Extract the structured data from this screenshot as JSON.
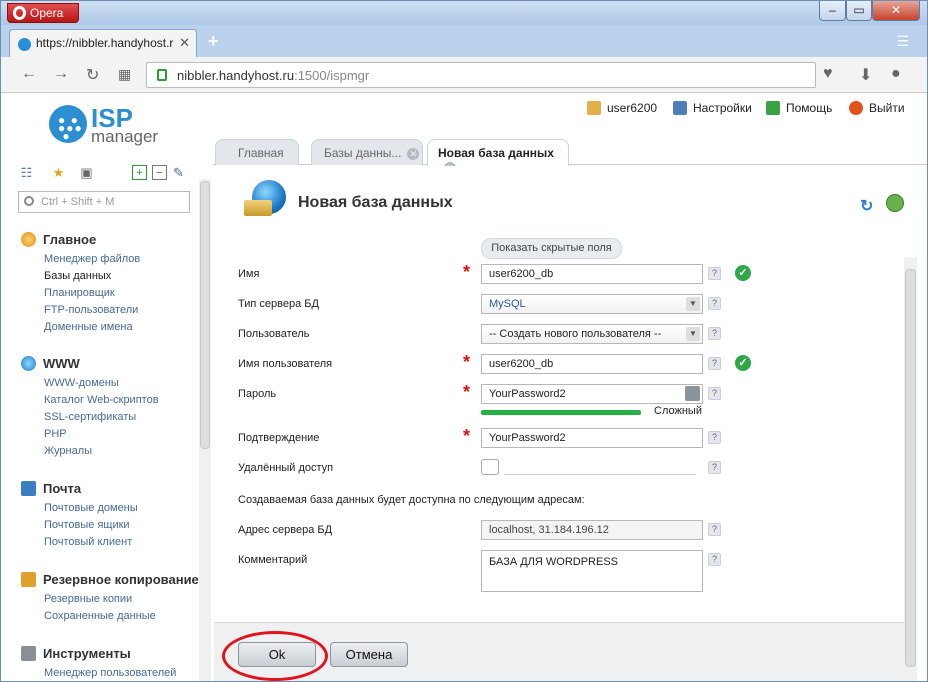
{
  "browser": {
    "app_name": "Opera",
    "tab_title": "https://nibbler.handyhost.r",
    "url_host": "nibbler.handyhost.ru",
    "url_rest": ":1500/ispmgr",
    "win_min": "–",
    "win_max": "▭",
    "win_close": "✕",
    "new_tab": "+"
  },
  "app": {
    "logo_top": "ISP",
    "logo_bottom": "manager",
    "user": "user6200",
    "settings": "Настройки",
    "help": "Помощь",
    "logout": "Выйти",
    "tabs": [
      {
        "label": "Главная"
      },
      {
        "label": "Базы данны..."
      },
      {
        "label": "Новая база данных"
      }
    ]
  },
  "sidebar": {
    "search_placeholder": "Ctrl + Shift + M",
    "groups": [
      {
        "title": "Главное",
        "items": [
          "Менеджер файлов",
          "Базы данных",
          "Планировщик",
          "FTP-пользователи",
          "Доменные имена"
        ]
      },
      {
        "title": "WWW",
        "items": [
          "WWW-домены",
          "Каталог Web-скриптов",
          "SSL-сертификаты",
          "PHP",
          "Журналы"
        ]
      },
      {
        "title": "Почта",
        "items": [
          "Почтовые домены",
          "Почтовые ящики",
          "Почтовый клиент"
        ]
      },
      {
        "title": "Резервное копирование",
        "items": [
          "Резервные копии",
          "Сохраненные данные"
        ]
      },
      {
        "title": "Инструменты",
        "items": [
          "Менеджер пользователей"
        ]
      }
    ]
  },
  "form": {
    "title": "Новая база данных",
    "show_hidden": "Показать скрытые поля",
    "name_label": "Имя",
    "name_value": "user6200_db",
    "server_type_label": "Тип сервера БД",
    "server_type_value": "MySQL",
    "user_label": "Пользователь",
    "user_value": "-- Создать нового пользователя --",
    "username_label": "Имя пользователя",
    "username_value": "user6200_db",
    "password_label": "Пароль",
    "password_value": "YourPassword2",
    "strength_label": "Сложный",
    "strength_level": 1.0,
    "confirm_label": "Подтверждение",
    "confirm_value": "YourPassword2",
    "remote_label": "Удалённый доступ",
    "note": "Создаваемая база данных будет доступна по следующим адресам:",
    "server_addr_label": "Адрес сервера БД",
    "server_addr_value": "localhost, 31.184.196.12",
    "comment_label": "Комментарий",
    "comment_value": "БАЗА ДЛЯ WORDPRESS",
    "ok": "Ok",
    "cancel": "Отмена",
    "help_mark": "?",
    "check_mark": "✓",
    "required_mark": "*"
  },
  "colors": {
    "accent": "#2b8fd1",
    "ok_green": "#2fa84a",
    "required_red": "#dd1111",
    "highlight_circle": "#e0141a"
  }
}
